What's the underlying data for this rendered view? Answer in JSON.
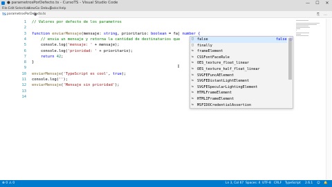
{
  "window": {
    "title": "● parametrosPorDefecto.ts - CursoTS - Visual Studio Code",
    "minimize": "—",
    "maximize": "☐",
    "close": "✕"
  },
  "menu": [
    "File",
    "Edit",
    "Selection",
    "View",
    "Go",
    "Debug",
    "Tasks",
    "Help"
  ],
  "tab": {
    "icon": "TS",
    "label": "parametrosPorDefecto.ts",
    "close": "●",
    "actions": [
      "⎘",
      "…"
    ]
  },
  "editor": {
    "line_numbers": [
      "1",
      "2",
      "3",
      "4",
      "5",
      "6",
      "7",
      "8",
      "9",
      "10",
      "11",
      "12",
      "13",
      "14"
    ],
    "lines": [
      [
        {
          "t": "// Valores por defecto de los parametros",
          "c": "cm"
        }
      ],
      [],
      [
        {
          "t": "function ",
          "c": "kw"
        },
        {
          "t": "enviarMensaje",
          "c": "fn"
        },
        {
          "t": "(mensaje: "
        },
        {
          "t": "string",
          "c": "tp"
        },
        {
          "t": ", prioritario: "
        },
        {
          "t": "boolean",
          "c": "tp"
        },
        {
          "t": " = fa"
        },
        {
          "t": "|"
        },
        {
          "t": " number {",
          "c": "tp"
        }
      ],
      [
        {
          "t": "    // envia un mensaje y retorna la cantidad de destinatarios que",
          "c": "cm"
        }
      ],
      [
        {
          "t": "    console.log("
        },
        {
          "t": "'mensaje: '",
          "c": "st"
        },
        {
          "t": " + mensaje);"
        }
      ],
      [
        {
          "t": "    console.log("
        },
        {
          "t": "'prioridad: '",
          "c": "st"
        },
        {
          "t": " + prioritario);"
        }
      ],
      [
        {
          "t": "    return ",
          "c": "kw"
        },
        {
          "t": "42",
          "c": "nm"
        },
        {
          "t": ";"
        }
      ],
      [
        {
          "t": "}"
        }
      ],
      [],
      [
        {
          "t": "enviarMensaje",
          "c": "fn"
        },
        {
          "t": "("
        },
        {
          "t": "'TypeScript es cool'",
          "c": "st"
        },
        {
          "t": ", "
        },
        {
          "t": "true",
          "c": "kw"
        },
        {
          "t": ");"
        }
      ],
      [
        {
          "t": "console.log("
        },
        {
          "t": "''",
          "c": "st"
        },
        {
          "t": ");"
        }
      ],
      [
        {
          "t": "enviarMensaje",
          "c": "fn"
        },
        {
          "t": "("
        },
        {
          "t": "'Mensaje sin prioridad'",
          "c": "st"
        },
        {
          "t": ");"
        }
      ],
      [],
      []
    ]
  },
  "suggest": {
    "items": [
      {
        "icon": "□",
        "label": "false",
        "detail": "false ⓘ"
      },
      {
        "icon": "□",
        "label": "finally",
        "detail": ""
      },
      {
        "icon": "⇆",
        "label": "frameElement",
        "detail": ""
      },
      {
        "icon": "⇆",
        "label": "CSSFontFaceRule",
        "detail": ""
      },
      {
        "icon": "⇆",
        "label": "OES_texture_float_linear",
        "detail": ""
      },
      {
        "icon": "⇆",
        "label": "OES_texture_half_float_linear",
        "detail": ""
      },
      {
        "icon": "⇆",
        "label": "SVGFEFuncAElement",
        "detail": ""
      },
      {
        "icon": "⇆",
        "label": "SVGFEDistantLightElement",
        "detail": ""
      },
      {
        "icon": "⇆",
        "label": "SVGFESpecularLightingElement",
        "detail": ""
      },
      {
        "icon": "⇆",
        "label": "HTMLFrameElement",
        "detail": ""
      },
      {
        "icon": "⇆",
        "label": "HTMLIFrameElement",
        "detail": ""
      },
      {
        "icon": "⇆",
        "label": "MSFIDOCredentialAssertion",
        "detail": ""
      }
    ]
  },
  "cursor_icon": "I",
  "status": {
    "left": "⊗ 0 ⚠ 0",
    "items": [
      "Ln 3, Col 67",
      "Spaces: 4",
      "UTF-8",
      "CRLF",
      "TypeScript",
      "2.6.1",
      "☺",
      "🔔"
    ]
  },
  "colors": {
    "status_bar": "#007acc",
    "keyword": "#0000ff",
    "comment": "#008000",
    "string": "#a31515",
    "number": "#098658",
    "suggest_selected": "#d6ebff"
  }
}
